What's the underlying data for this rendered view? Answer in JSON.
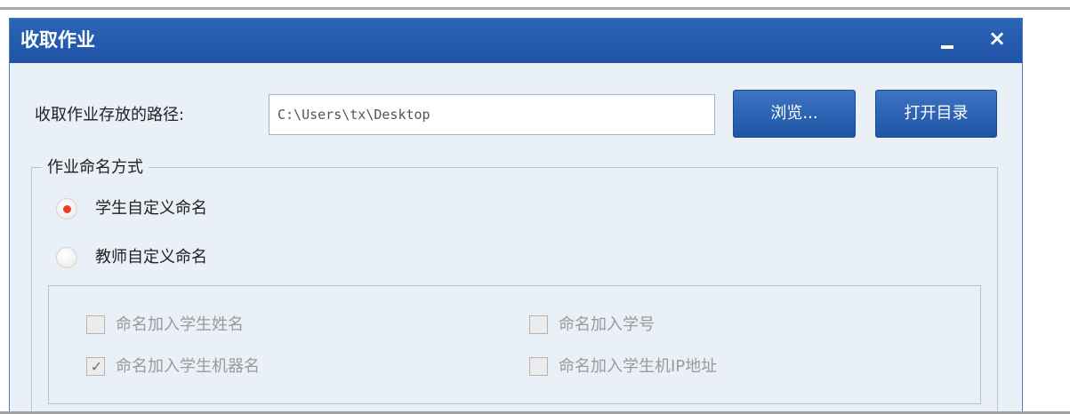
{
  "window": {
    "title": "收取作业",
    "minimize_symbol": "—",
    "close_symbol": "×"
  },
  "path": {
    "label": "收取作业存放的路径:",
    "value": "C:\\Users\\tx\\Desktop"
  },
  "buttons": {
    "browse": "浏览...",
    "open_dir": "打开目录"
  },
  "naming": {
    "legend": "作业命名方式",
    "options": [
      {
        "label": "学生自定义命名",
        "selected": true
      },
      {
        "label": "教师自定义命名",
        "selected": false
      }
    ],
    "checkboxes": [
      {
        "label": "命名加入学生姓名",
        "checked": false
      },
      {
        "label": "命名加入学号",
        "checked": false
      },
      {
        "label": "命名加入学生机器名",
        "checked": true,
        "mark": "✓"
      },
      {
        "label": "命名加入学生机IP地址",
        "checked": false
      }
    ]
  },
  "colors": {
    "titlebar": "#2458ac",
    "window_bg": "#eaf0f7",
    "radio_dot": "#e8402a"
  }
}
